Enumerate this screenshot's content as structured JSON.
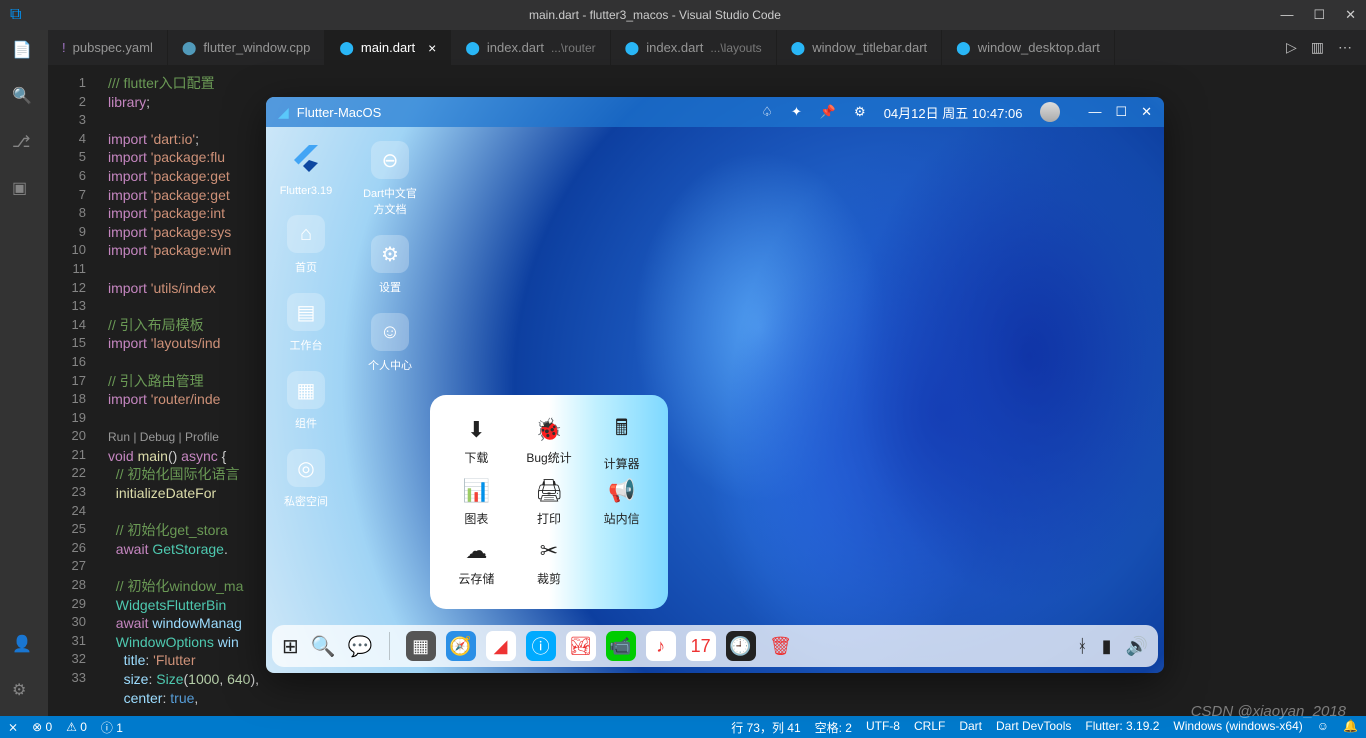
{
  "vscode": {
    "title": "main.dart - flutter3_macos - Visual Studio Code",
    "tabs": [
      {
        "icon": "!",
        "iconColor": "#a074c4",
        "label": "pubspec.yaml"
      },
      {
        "icon": "⬤",
        "iconColor": "#519aba",
        "label": "flutter_window.cpp"
      },
      {
        "icon": "⬤",
        "iconColor": "#29b6f6",
        "label": "main.dart",
        "active": true,
        "close": "×"
      },
      {
        "icon": "⬤",
        "iconColor": "#29b6f6",
        "label": "index.dart",
        "suffix": "...\\router"
      },
      {
        "icon": "⬤",
        "iconColor": "#29b6f6",
        "label": "index.dart",
        "suffix": "...\\layouts"
      },
      {
        "icon": "⬤",
        "iconColor": "#29b6f6",
        "label": "window_titlebar.dart"
      },
      {
        "icon": "⬤",
        "iconColor": "#29b6f6",
        "label": "window_desktop.dart"
      }
    ],
    "tab_actions": {
      "run": "▷",
      "split": "▥",
      "more": "⋯"
    },
    "lines": [
      "1",
      "2",
      "3",
      "4",
      "5",
      "6",
      "7",
      "8",
      "9",
      "10",
      "11",
      "12",
      "13",
      "14",
      "15",
      "16",
      "17",
      "18",
      "19",
      "",
      "20",
      "21",
      "22",
      "23",
      "24",
      "25",
      "26",
      "27",
      "28",
      "29",
      "30",
      "31",
      "32",
      "33"
    ],
    "code_html": "<span class='c-comment'>/// flutter入口配置</span>\n<span class='c-kw'>library</span>;\n\n<span class='c-kw'>import</span> <span class='c-str'>'dart:io'</span>;\n<span class='c-kw'>import</span> <span class='c-str'>'package:flu</span>\n<span class='c-kw'>import</span> <span class='c-str'>'package:get</span>\n<span class='c-kw'>import</span> <span class='c-str'>'package:get</span>\n<span class='c-kw'>import</span> <span class='c-str'>'package:int</span>\n<span class='c-kw'>import</span> <span class='c-str'>'package:sys</span>\n<span class='c-kw'>import</span> <span class='c-str'>'package:win</span>\n\n<span class='c-kw'>import</span> <span class='c-str'>'utils/index</span>\n\n<span class='c-comment'>// 引入布局模板</span>\n<span class='c-kw'>import</span> <span class='c-str'>'layouts/ind</span>\n\n<span class='c-comment'>// 引入路由管理</span>\n<span class='c-kw'>import</span> <span class='c-str'>'router/inde</span>\n\n<span class='c-run'>Run | Debug | Profile</span>\n<span class='c-kw'>void</span> <span class='c-fn'>main</span>() <span class='c-kw'>async</span> {\n  <span class='c-comment'>// 初始化国际化语言</span>\n  <span class='c-fn'>initializeDateFor</span>\n\n  <span class='c-comment'>// 初始化get_stora</span>\n  <span class='c-kw'>await</span> <span class='c-type'>GetStorage</span>.\n\n  <span class='c-comment'>// 初始化window_ma</span>\n  <span class='c-type'>WidgetsFlutterBin</span>\n  <span class='c-kw'>await</span> <span class='c-id'>windowManag</span>\n  <span class='c-type'>WindowOptions</span> <span class='c-id'>win</span>\n    <span class='c-id'>title</span>: <span class='c-str'>'Flutter</span>\n    <span class='c-id'>size</span>: <span class='c-type'>Size</span>(<span class='c-num'>1000</span>, <span class='c-num'>640</span>),\n    <span class='c-id'>center</span>: <span class='c-lit'>true</span>,",
    "status": {
      "remote": "⨯",
      "errors": "⊗ 0",
      "warnings": "⚠ 0",
      "info": "ⓘ 1",
      "pos": "行 73，列 41",
      "spaces": "空格: 2",
      "encoding": "UTF-8",
      "eol": "CRLF",
      "lang": "Dart",
      "devtools": "Dart DevTools",
      "flutter": "Flutter: 3.19.2",
      "device": "Windows (windows-x64)",
      "bell": "🔔"
    }
  },
  "macos": {
    "title": "Flutter-MacOS",
    "tbar": {
      "date": "04月12日 周五 10:47:06",
      "min": "—",
      "max": "☐",
      "close": "✕"
    },
    "sidebar": [
      {
        "name": "flutter",
        "label": "Flutter3.19"
      },
      {
        "name": "home",
        "icon": "⌂",
        "label": "首页"
      },
      {
        "name": "workbench",
        "icon": "▤",
        "label": "工作台"
      },
      {
        "name": "widgets",
        "icon": "▦",
        "label": "组件"
      },
      {
        "name": "private",
        "icon": "◎",
        "label": "私密空间"
      }
    ],
    "col2": [
      {
        "name": "dart-doc",
        "icon": "⊖",
        "label": "Dart中文官\n方文档"
      },
      {
        "name": "settings",
        "icon": "⚙",
        "label": "设置"
      },
      {
        "name": "profile",
        "icon": "☺",
        "label": "个人中心"
      }
    ],
    "popup": [
      {
        "name": "download",
        "icon": "⬇",
        "label": "下载"
      },
      {
        "name": "bug",
        "icon": "🐞",
        "label": "Bug统计"
      },
      {
        "name": "calc",
        "icon": "🖩",
        "label": "计算器"
      },
      {
        "name": "chart",
        "icon": "📊",
        "label": "图表"
      },
      {
        "name": "print",
        "icon": "🖨",
        "label": "打印"
      },
      {
        "name": "mail",
        "icon": "📢",
        "label": "站内信"
      },
      {
        "name": "cloud",
        "icon": "☁",
        "label": "云存储"
      },
      {
        "name": "crop",
        "icon": "✂",
        "label": "裁剪"
      }
    ],
    "dock": {
      "left": [
        {
          "name": "grid",
          "icon": "⊞"
        },
        {
          "name": "search",
          "icon": "🔍"
        },
        {
          "name": "wechat",
          "icon": "💬"
        }
      ],
      "mid": [
        {
          "name": "apps",
          "bg": "#555",
          "icon": "▦"
        },
        {
          "name": "safari",
          "bg": "#2b8fe6",
          "icon": "🧭"
        },
        {
          "name": "flutter",
          "bg": "#fff",
          "icon": "◢"
        },
        {
          "name": "info",
          "bg": "#0af",
          "icon": "ⓘ"
        },
        {
          "name": "photos",
          "bg": "#fff",
          "icon": "🏞"
        },
        {
          "name": "facetime",
          "bg": "#0c0",
          "icon": "📹"
        },
        {
          "name": "music",
          "bg": "#fff",
          "icon": "♪"
        },
        {
          "name": "calendar",
          "bg": "#fff",
          "icon": "17"
        },
        {
          "name": "clock",
          "bg": "#222",
          "icon": "🕘"
        },
        {
          "name": "trash",
          "bg": "transparent",
          "icon": "🗑"
        }
      ],
      "right": [
        {
          "name": "bluetooth",
          "icon": "ᚼ"
        },
        {
          "name": "battery",
          "icon": "▮"
        },
        {
          "name": "volume",
          "icon": "🔊"
        }
      ]
    }
  },
  "watermark": "CSDN @xiaoyan_2018"
}
